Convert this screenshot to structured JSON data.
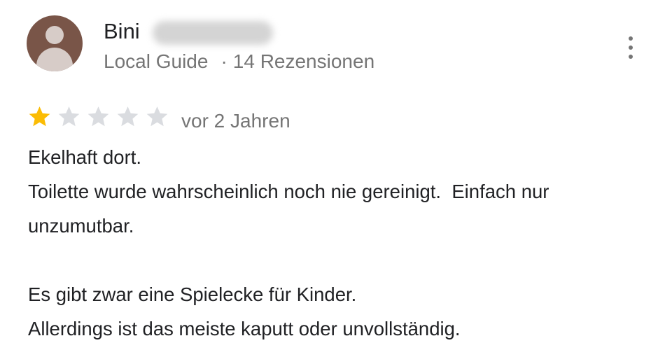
{
  "reviewer": {
    "name": "Bini",
    "badge": "Local Guide",
    "separator": "·",
    "review_count": "14 Rezensionen"
  },
  "rating": {
    "stars": 1,
    "max_stars": 5,
    "filled_color": "#fbbc04",
    "empty_color": "#dadce0"
  },
  "review": {
    "date": "vor 2 Jahren",
    "lines": [
      "Ekelhaft dort.",
      "Toilette wurde wahrscheinlich noch nie gereinigt.  Einfach nur unzumutbar.",
      "",
      "Es gibt zwar eine Spielecke für Kinder.",
      "Allerdings ist das meiste kaputt oder unvollständig."
    ]
  },
  "icons": {
    "avatar": "person-icon",
    "more": "more-vert-icon",
    "star": "star-icon"
  },
  "colors": {
    "avatar_bg": "#795548",
    "avatar_fg": "#d7ccc8",
    "secondary_text": "#757575",
    "primary_text": "#202124"
  }
}
